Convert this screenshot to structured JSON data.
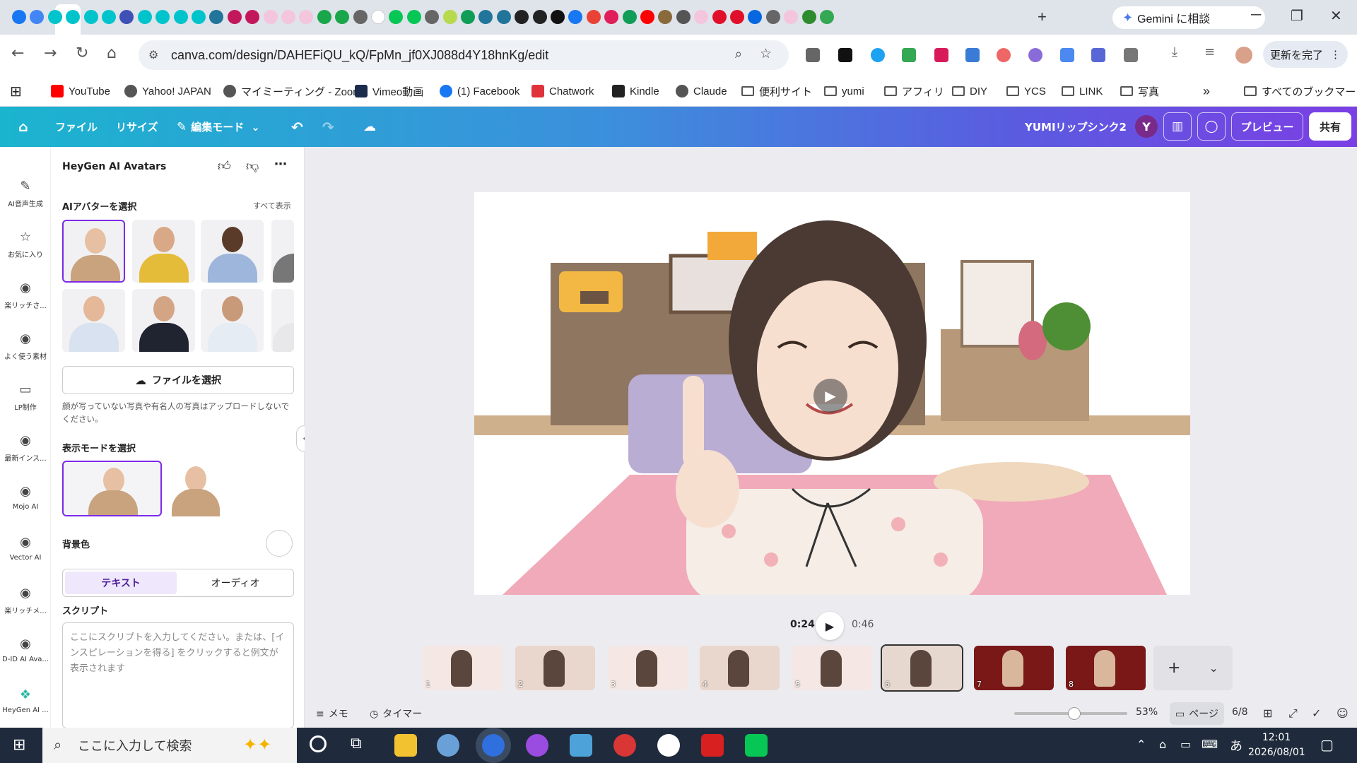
{
  "browser": {
    "tab_icons": [
      "facebook-icon",
      "chrome-icon",
      "canva-icon",
      "canva-icon",
      "canva-icon",
      "canva-icon",
      "heart-icon",
      "canva-icon",
      "canva-icon",
      "canva-icon",
      "canva-icon",
      "wordpress-icon",
      "pocket-icon",
      "pocket-icon",
      "f-icon",
      "f-icon",
      "f-icon",
      "headset-icon",
      "headset-icon",
      "globe-icon",
      "google-icon",
      "line-icon",
      "line-icon",
      "globe-icon",
      "ring-icon",
      "sheets-icon",
      "wordpress-icon",
      "wordpress-icon",
      "amazon-icon",
      "amazon-icon",
      "kindle-icon",
      "facebook-icon",
      "gmail-icon",
      "slack-icon",
      "sheets-icon",
      "youtube-icon",
      "photo-icon",
      "chatgpt-icon",
      "f-icon",
      "red-dot-icon",
      "red-dot-icon",
      "meta-icon",
      "globe-icon",
      "f-icon",
      "df-icon",
      "maps-icon"
    ],
    "gemini_label": "Gemini に相談",
    "url": "canva.com/design/DAHEFiQU_kQ/FpMn_jf0XJ088d4Y18hnKg/edit",
    "update_label": "更新を完了"
  },
  "bookmarks": [
    {
      "label": "YouTube",
      "icon": "youtube-icon",
      "color": "#ff0000"
    },
    {
      "label": "Yahoo! JAPAN",
      "icon": "globe-icon",
      "color": "#555555"
    },
    {
      "label": "マイミーティング - Zoom",
      "icon": "globe-icon",
      "color": "#555555"
    },
    {
      "label": "Vimeo動画",
      "icon": "vimeo-icon",
      "color": "#1a2b4c"
    },
    {
      "label": "(1) Facebook",
      "icon": "facebook-icon",
      "color": "#1877f2"
    },
    {
      "label": "Chatwork",
      "icon": "chatwork-icon",
      "color": "#e0323a"
    },
    {
      "label": "Kindle",
      "icon": "amazon-icon",
      "color": "#222222"
    },
    {
      "label": "Claude",
      "icon": "globe-icon",
      "color": "#555555"
    },
    {
      "label": "便利サイト",
      "icon": "folder-icon",
      "color": ""
    },
    {
      "label": "yumi",
      "icon": "folder-icon",
      "color": ""
    },
    {
      "label": "アフィリ",
      "icon": "folder-icon",
      "color": ""
    },
    {
      "label": "DIY",
      "icon": "folder-icon",
      "color": ""
    },
    {
      "label": "YCS",
      "icon": "folder-icon",
      "color": ""
    },
    {
      "label": "LINK",
      "icon": "folder-icon",
      "color": ""
    },
    {
      "label": "写真",
      "icon": "folder-icon",
      "color": ""
    }
  ],
  "bookmarks_more": "»",
  "all_bookmarks": "すべてのブックマーク",
  "canva": {
    "file": "ファイル",
    "resize": "リサイズ",
    "edit_mode": "編集モード",
    "project_title": "YUMIリップシンク2",
    "avatar_letter": "Y",
    "preview": "プレビュー",
    "share": "共有"
  },
  "rail": [
    {
      "label": "AI音声生成",
      "icon": "ai-voice-icon"
    },
    {
      "label": "お気に入り",
      "icon": "star-icon"
    },
    {
      "label": "楽リッチさ...",
      "icon": "app-icon"
    },
    {
      "label": "よく使う素材",
      "icon": "app-icon"
    },
    {
      "label": "LP制作",
      "icon": "folder-icon"
    },
    {
      "label": "最新インス...",
      "icon": "app-icon"
    },
    {
      "label": "Mojo AI",
      "icon": "app-icon"
    },
    {
      "label": "Vector AI",
      "icon": "app-icon"
    },
    {
      "label": "楽リッチメ...",
      "icon": "app-icon"
    },
    {
      "label": "D-ID AI Ava...",
      "icon": "app-icon"
    },
    {
      "label": "HeyGen AI ...",
      "icon": "heygen-icon"
    }
  ],
  "panel": {
    "title": "HeyGen AI Avatars",
    "avatar_section": "AIアバターを選択",
    "show_all": "すべて表示",
    "file_button": "ファイルを選択",
    "upload_note": "顔が写っていない写真や有名人の写真はアップロードしないでください。",
    "display_mode": "表示モードを選択",
    "bg_color": "背景色",
    "tab_text": "テキスト",
    "tab_audio": "オーディオ",
    "script_title": "スクリプト",
    "script_placeholder": "ここにスクリプトを入力してください。または、[インスピレーションを得る] をクリックすると例文が表示されます"
  },
  "player": {
    "current": "0:24",
    "total": "0:46"
  },
  "pages": [
    "1",
    "2",
    "3",
    "4",
    "5",
    "6",
    "7",
    "8"
  ],
  "footer": {
    "memo": "メモ",
    "timer": "タイマー",
    "zoom": "53%",
    "zoom_fraction": 0.53,
    "page_label": "ページ",
    "page_count": "6/8"
  },
  "taskbar": {
    "search_placeholder": "ここに入力して検索",
    "time": "12:01",
    "date": "2026/08/01",
    "ime": "あ"
  }
}
